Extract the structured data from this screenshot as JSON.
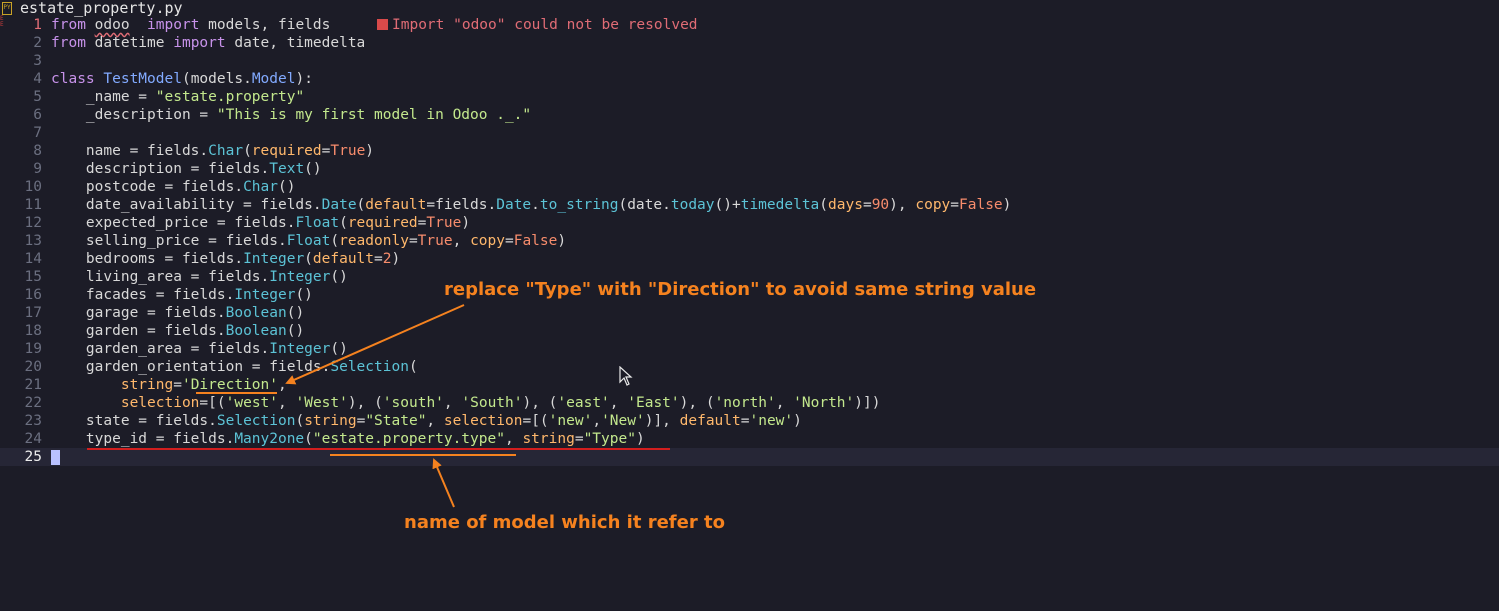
{
  "file": {
    "name": "estate_property.py"
  },
  "editor": {
    "diagnostic": "Import \"odoo\" could not be resolved",
    "lines": [
      {
        "n": "1",
        "tokens": [
          [
            "kw",
            "from "
          ],
          [
            "sq",
            "odoo"
          ],
          [
            "",
            "  "
          ],
          [
            "kw",
            "import "
          ],
          [
            "",
            "models, fields"
          ]
        ]
      },
      {
        "n": "2",
        "tokens": [
          [
            "kw",
            "from "
          ],
          [
            "",
            "datetime "
          ],
          [
            "kw",
            "import "
          ],
          [
            "",
            "date, timedelta"
          ]
        ]
      },
      {
        "n": "3",
        "tokens": []
      },
      {
        "n": "4",
        "tokens": [
          [
            "kw",
            "class "
          ],
          [
            "cls",
            "TestModel"
          ],
          [
            "",
            "(models."
          ],
          [
            "cls",
            "Model"
          ],
          [
            "",
            "):"
          ]
        ]
      },
      {
        "n": "5",
        "tokens": [
          [
            "",
            "    _name = "
          ],
          [
            "str",
            "\"estate.property\""
          ]
        ]
      },
      {
        "n": "6",
        "tokens": [
          [
            "",
            "    _description = "
          ],
          [
            "str",
            "\"This is my first model in Odoo ._.\""
          ]
        ]
      },
      {
        "n": "7",
        "tokens": []
      },
      {
        "n": "8",
        "tokens": [
          [
            "",
            "    name = fields."
          ],
          [
            "fn",
            "Char"
          ],
          [
            "",
            "("
          ],
          [
            "arg",
            "required"
          ],
          [
            "",
            "="
          ],
          [
            "bool",
            "True"
          ],
          [
            "",
            ")"
          ]
        ]
      },
      {
        "n": "9",
        "tokens": [
          [
            "",
            "    description = fields."
          ],
          [
            "fn",
            "Text"
          ],
          [
            "",
            "()"
          ]
        ]
      },
      {
        "n": "10",
        "tokens": [
          [
            "",
            "    postcode = fields."
          ],
          [
            "fn",
            "Char"
          ],
          [
            "",
            "()"
          ]
        ]
      },
      {
        "n": "11",
        "tokens": [
          [
            "",
            "    date_availability = fields."
          ],
          [
            "fn",
            "Date"
          ],
          [
            "",
            "("
          ],
          [
            "arg",
            "default"
          ],
          [
            "",
            "=fields."
          ],
          [
            "fn",
            "Date"
          ],
          [
            "",
            "."
          ],
          [
            "fn",
            "to_string"
          ],
          [
            "",
            "(date."
          ],
          [
            "fn",
            "today"
          ],
          [
            "",
            "()+"
          ],
          [
            "fn",
            "timedelta"
          ],
          [
            "",
            "("
          ],
          [
            "arg",
            "days"
          ],
          [
            "",
            "="
          ],
          [
            "num",
            "90"
          ],
          [
            "",
            "), "
          ],
          [
            "arg",
            "copy"
          ],
          [
            "",
            "="
          ],
          [
            "bool",
            "False"
          ],
          [
            "",
            ")"
          ]
        ]
      },
      {
        "n": "12",
        "tokens": [
          [
            "",
            "    expected_price = fields."
          ],
          [
            "fn",
            "Float"
          ],
          [
            "",
            "("
          ],
          [
            "arg",
            "required"
          ],
          [
            "",
            "="
          ],
          [
            "bool",
            "True"
          ],
          [
            "",
            ")"
          ]
        ]
      },
      {
        "n": "13",
        "tokens": [
          [
            "",
            "    selling_price = fields."
          ],
          [
            "fn",
            "Float"
          ],
          [
            "",
            "("
          ],
          [
            "arg",
            "readonly"
          ],
          [
            "",
            "="
          ],
          [
            "bool",
            "True"
          ],
          [
            "",
            ", "
          ],
          [
            "arg",
            "copy"
          ],
          [
            "",
            "="
          ],
          [
            "bool",
            "False"
          ],
          [
            "",
            ")"
          ]
        ]
      },
      {
        "n": "14",
        "tokens": [
          [
            "",
            "    bedrooms = fields."
          ],
          [
            "fn",
            "Integer"
          ],
          [
            "",
            "("
          ],
          [
            "arg",
            "default"
          ],
          [
            "",
            "="
          ],
          [
            "num",
            "2"
          ],
          [
            "",
            ")"
          ]
        ]
      },
      {
        "n": "15",
        "tokens": [
          [
            "",
            "    living_area = fields."
          ],
          [
            "fn",
            "Integer"
          ],
          [
            "",
            "()"
          ]
        ]
      },
      {
        "n": "16",
        "tokens": [
          [
            "",
            "    facades = fields."
          ],
          [
            "fn",
            "Integer"
          ],
          [
            "",
            "()"
          ]
        ]
      },
      {
        "n": "17",
        "tokens": [
          [
            "",
            "    garage = fields."
          ],
          [
            "fn",
            "Boolean"
          ],
          [
            "",
            "()"
          ]
        ]
      },
      {
        "n": "18",
        "tokens": [
          [
            "",
            "    garden = fields."
          ],
          [
            "fn",
            "Boolean"
          ],
          [
            "",
            "()"
          ]
        ]
      },
      {
        "n": "19",
        "tokens": [
          [
            "",
            "    garden_area = fields."
          ],
          [
            "fn",
            "Integer"
          ],
          [
            "",
            "()"
          ]
        ]
      },
      {
        "n": "20",
        "tokens": [
          [
            "",
            "    garden_orientation = fields."
          ],
          [
            "fn",
            "Selection"
          ],
          [
            "",
            "("
          ]
        ]
      },
      {
        "n": "21",
        "tokens": [
          [
            "",
            "        "
          ],
          [
            "arg",
            "string"
          ],
          [
            "",
            "="
          ],
          [
            "str",
            "'Direction'"
          ],
          [
            "",
            ","
          ]
        ]
      },
      {
        "n": "22",
        "tokens": [
          [
            "",
            "        "
          ],
          [
            "arg",
            "selection"
          ],
          [
            "",
            "=[("
          ],
          [
            "str",
            "'west'"
          ],
          [
            "",
            ", "
          ],
          [
            "str",
            "'West'"
          ],
          [
            "",
            "), ("
          ],
          [
            "str",
            "'south'"
          ],
          [
            "",
            ", "
          ],
          [
            "str",
            "'South'"
          ],
          [
            "",
            "), ("
          ],
          [
            "str",
            "'east'"
          ],
          [
            "",
            ", "
          ],
          [
            "str",
            "'East'"
          ],
          [
            "",
            "), ("
          ],
          [
            "str",
            "'north'"
          ],
          [
            "",
            ", "
          ],
          [
            "str",
            "'North'"
          ],
          [
            "",
            ")])"
          ]
        ]
      },
      {
        "n": "23",
        "tokens": [
          [
            "",
            "    state = fields."
          ],
          [
            "fn",
            "Selection"
          ],
          [
            "",
            "("
          ],
          [
            "arg",
            "string"
          ],
          [
            "",
            "="
          ],
          [
            "str",
            "\"State\""
          ],
          [
            "",
            ", "
          ],
          [
            "arg",
            "selection"
          ],
          [
            "",
            "=[("
          ],
          [
            "str",
            "'new'"
          ],
          [
            "",
            ","
          ],
          [
            "str",
            "'New'"
          ],
          [
            "",
            ")], "
          ],
          [
            "arg",
            "default"
          ],
          [
            "",
            "="
          ],
          [
            "str",
            "'new'"
          ],
          [
            "",
            ")"
          ]
        ]
      },
      {
        "n": "24",
        "tokens": [
          [
            "",
            "    type_id = fields."
          ],
          [
            "fn",
            "Many2one"
          ],
          [
            "",
            "("
          ],
          [
            "str",
            "\"estate.property.type\""
          ],
          [
            "",
            ", "
          ],
          [
            "arg",
            "string"
          ],
          [
            "",
            "="
          ],
          [
            "str",
            "\"Type\""
          ],
          [
            "",
            ")"
          ]
        ]
      },
      {
        "n": "25",
        "tokens": []
      }
    ]
  },
  "annotations": {
    "top": "replace \"Type\" with \"Direction\" to avoid same string value",
    "bottom": "name of model which it refer to"
  },
  "colors": {
    "annotation": "#f5821f",
    "underline_red": "#d21e1e"
  }
}
